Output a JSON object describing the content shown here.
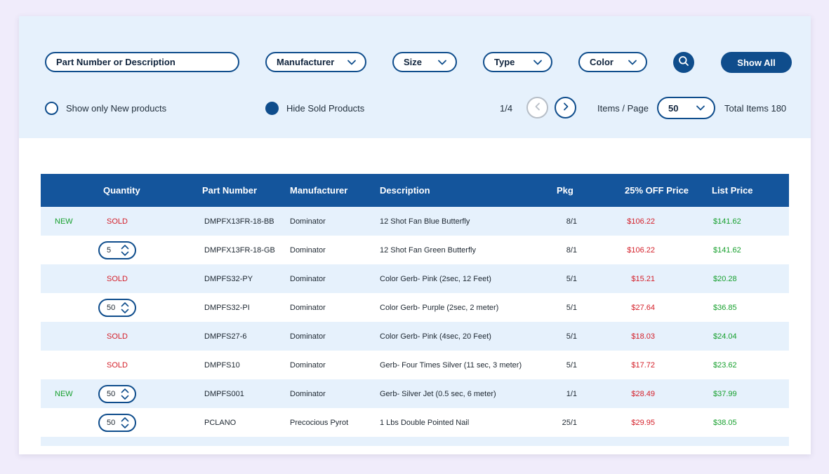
{
  "filters": {
    "search_placeholder": "Part Number or Description",
    "manufacturer": "Manufacturer",
    "size": "Size",
    "type": "Type",
    "color": "Color",
    "show_all": "Show All",
    "show_new_label": "Show only New products",
    "show_new_checked": false,
    "hide_sold_label": "Hide Sold Products",
    "hide_sold_checked": true
  },
  "pagination": {
    "page": "1/4",
    "items_per_page_label": "Items / Page",
    "items_per_page": "50",
    "total_items": "Total Items 180"
  },
  "colors": {
    "primary": "#0f4d8c",
    "header": "#14559c",
    "panel": "#e6f1fc",
    "new": "#17a02e",
    "sold": "#d4202a"
  },
  "table": {
    "columns": [
      "",
      "Quantity",
      "Part Number",
      "Manufacturer",
      "Description",
      "Pkg",
      "25% OFF Price",
      "List Price"
    ],
    "rows": [
      {
        "badge": "NEW",
        "sold": "SOLD",
        "qty": "",
        "part": "DMPFX13FR-18-BB",
        "manufacturer": "Dominator",
        "description": "12 Shot Fan Blue Butterfly",
        "pkg": "8/1",
        "sale_price": "$106.22",
        "list_price": "$141.62"
      },
      {
        "badge": "",
        "sold": "",
        "qty": "5",
        "part": "DMPFX13FR-18-GB",
        "manufacturer": "Dominator",
        "description": "12 Shot Fan Green Butterfly",
        "pkg": "8/1",
        "sale_price": "$106.22",
        "list_price": "$141.62"
      },
      {
        "badge": "",
        "sold": "SOLD",
        "qty": "",
        "part": "DMPFS32-PY",
        "manufacturer": "Dominator",
        "description": "Color Gerb- Pink (2sec, 12 Feet)",
        "pkg": "5/1",
        "sale_price": "$15.21",
        "list_price": "$20.28"
      },
      {
        "badge": "",
        "sold": "",
        "qty": "50",
        "part": "DMPFS32-PI",
        "manufacturer": "Dominator",
        "description": "Color Gerb- Purple (2sec, 2 meter)",
        "pkg": "5/1",
        "sale_price": "$27.64",
        "list_price": "$36.85"
      },
      {
        "badge": "",
        "sold": "SOLD",
        "qty": "",
        "part": "DMPFS27-6",
        "manufacturer": "Dominator",
        "description": "Color Gerb- Pink (4sec, 20 Feet)",
        "pkg": "5/1",
        "sale_price": "$18.03",
        "list_price": "$24.04"
      },
      {
        "badge": "",
        "sold": "SOLD",
        "qty": "",
        "part": "DMPFS10",
        "manufacturer": "Dominator",
        "description": "Gerb- Four Times Silver (11 sec, 3 meter)",
        "pkg": "5/1",
        "sale_price": "$17.72",
        "list_price": "$23.62"
      },
      {
        "badge": "NEW",
        "sold": "",
        "qty": "50",
        "part": "DMPFS001",
        "manufacturer": "Dominator",
        "description": "Gerb- Silver Jet (0.5 sec, 6 meter)",
        "pkg": "1/1",
        "sale_price": "$28.49",
        "list_price": "$37.99"
      },
      {
        "badge": "",
        "sold": "",
        "qty": "50",
        "part": "PCLANO",
        "manufacturer": "Precocious Pyrot",
        "description": "1 Lbs Double Pointed Nail",
        "pkg": "25/1",
        "sale_price": "$29.95",
        "list_price": "$38.05"
      }
    ]
  }
}
